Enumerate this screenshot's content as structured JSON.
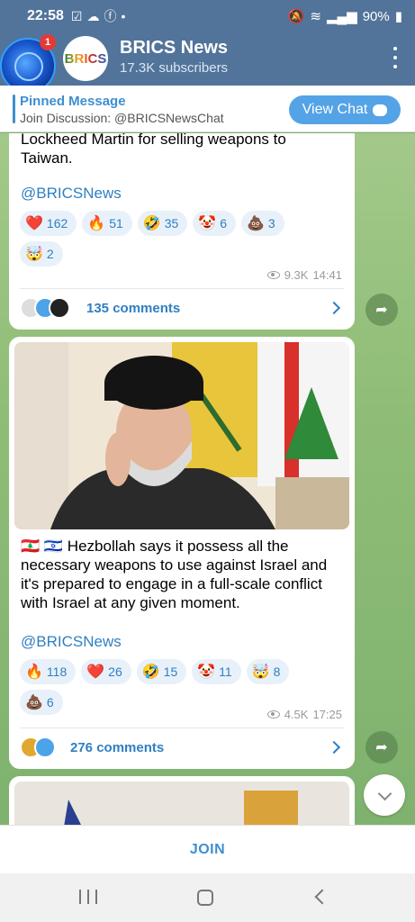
{
  "status_bar": {
    "time": "22:58",
    "battery": "90%"
  },
  "header": {
    "title": "BRICS News",
    "subscribers": "17.3K subscribers",
    "avatar_text": "BRICS",
    "unread_badge": "1"
  },
  "pinned": {
    "title": "Pinned Message",
    "text": "Join Discussion: @BRICSNewsChat",
    "view_chat_label": "View Chat"
  },
  "post1": {
    "text_line1": "Lockheed Martin for selling weapons to",
    "text_line2": "Taiwan.",
    "handle": "@BRICSNews",
    "reactions": [
      {
        "emoji": "❤️",
        "count": "162"
      },
      {
        "emoji": "🔥",
        "count": "51"
      },
      {
        "emoji": "🤣",
        "count": "35"
      },
      {
        "emoji": "🤡",
        "count": "6"
      },
      {
        "emoji": "💩",
        "count": "3"
      },
      {
        "emoji": "🤯",
        "count": "2"
      }
    ],
    "views": "9.3K",
    "time": "14:41",
    "comments": "135 comments"
  },
  "post2": {
    "flags": "🇱🇧 🇮🇱",
    "text_line1": "Hezbollah says it possess all the",
    "text_line2": "necessary weapons to use against Israel and",
    "text_line3": "it's prepared to engage in a full-scale conflict",
    "text_line4": "with Israel at any given moment.",
    "handle": "@BRICSNews",
    "reactions": [
      {
        "emoji": "🔥",
        "count": "118"
      },
      {
        "emoji": "❤️",
        "count": "26"
      },
      {
        "emoji": "🤣",
        "count": "15"
      },
      {
        "emoji": "🤡",
        "count": "11"
      },
      {
        "emoji": "🤯",
        "count": "8"
      },
      {
        "emoji": "💩",
        "count": "6"
      }
    ],
    "views": "4.5K",
    "time": "17:25",
    "comments": "276 comments"
  },
  "join_label": "JOIN",
  "colors": {
    "header": "#52749a",
    "accent": "#3e8ed0",
    "chat_bg": "#8fbd77"
  }
}
